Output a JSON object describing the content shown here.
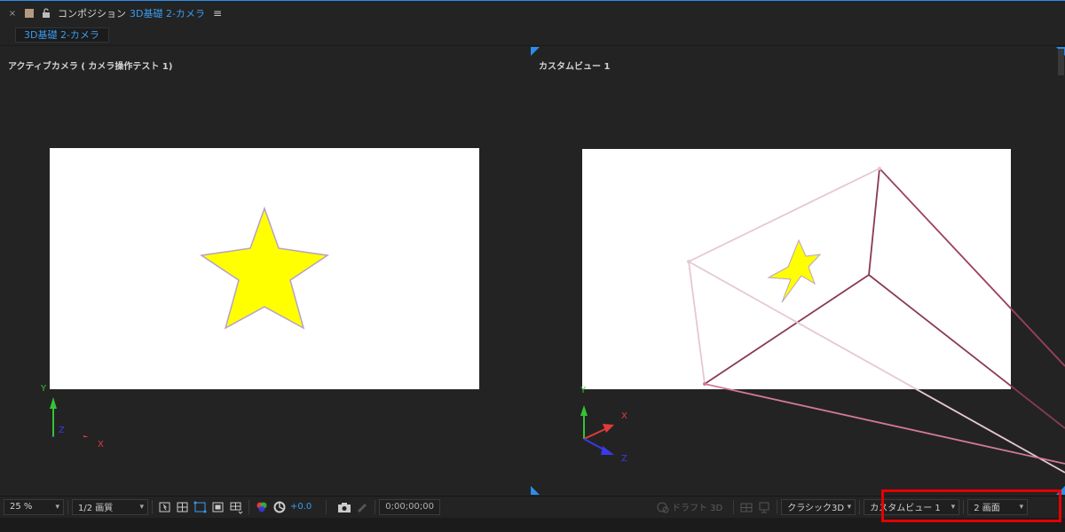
{
  "header": {
    "close_glyph": "×",
    "title": "コンポジション",
    "comp_name": "3D基礎 2-カメラ",
    "menu_glyph": "≡",
    "tab_label": "3D基礎 2-カメラ"
  },
  "left_view": {
    "label": "アクティブカメラ ( カメラ操作テスト 1)",
    "axis_y": "Y",
    "axis_z": "Z",
    "axis_x": "X"
  },
  "right_view": {
    "label": "カスタムビュー 1",
    "axis_y": "Y",
    "axis_x": "X",
    "axis_z": "Z"
  },
  "toolbar": {
    "zoom": "25 %",
    "resolution": "1/2 画質",
    "exposure": "+0.0",
    "timecode": "0;00;00;00",
    "draft3d": "ドラフト 3D",
    "renderer": "クラシック3D",
    "view_select": "カスタムビュー 1",
    "layout_select": "2 画面"
  },
  "colors": {
    "accent_blue": "#3a9bf0",
    "star_fill": "#ffff00",
    "highlight_red": "#e50000",
    "axis_x": "#e33b3b",
    "axis_y": "#35c435",
    "axis_z": "#3a3ae8"
  }
}
